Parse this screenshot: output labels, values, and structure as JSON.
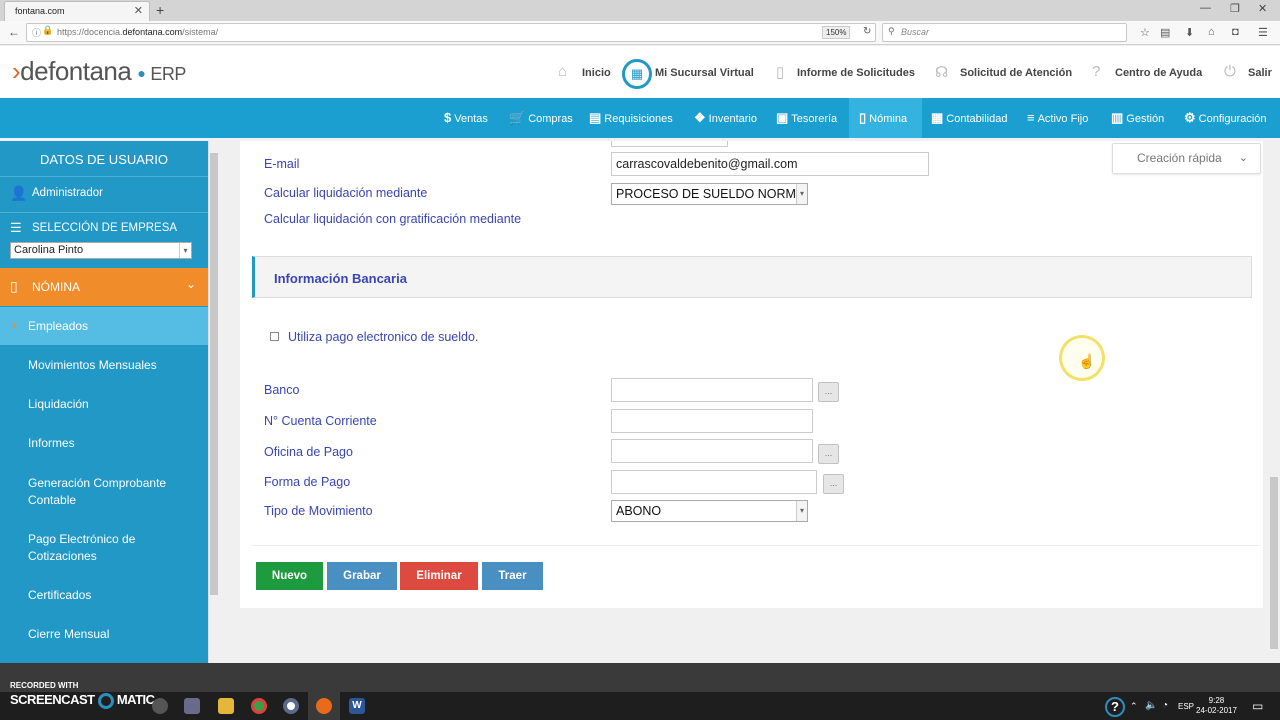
{
  "browser": {
    "tab_title": "fontana.com",
    "url_prefix": "https://docencia.",
    "url_domain": "defontana.com",
    "url_path": "/sistema/",
    "zoom": "150%",
    "search_placeholder": "Buscar"
  },
  "header": {
    "logo_main": "defontana",
    "logo_suffix": "ERP",
    "links": [
      "Inicio",
      "Mi Sucursal Virtual",
      "Informe de Solicitudes",
      "Solicitud de Atención",
      "Centro de Ayuda",
      "Salir"
    ]
  },
  "mainnav": {
    "items": [
      "Ventas",
      "Compras",
      "Requisiciones",
      "Inventario",
      "Tesorería",
      "Nómina",
      "Contabilidad",
      "Activo Fijo",
      "Gestión",
      "Configuración"
    ],
    "active": "Nómina"
  },
  "sidebar": {
    "title": "DATOS DE USUARIO",
    "user": "Administrador",
    "company_heading": "SELECCIÓN DE EMPRESA",
    "company_selected": "Carolina Pinto",
    "module": "NÓMINA",
    "items": [
      "Empleados",
      "Movimientos Mensuales",
      "Liquidación",
      "Informes",
      "Generación Comprobante Contable",
      "Pago Electrónico de Cotizaciones",
      "Certificados",
      "Cierre Mensual"
    ]
  },
  "form": {
    "email_label": "E-mail",
    "email_value": "carrascovaldebenito@gmail.com",
    "calc_label": "Calcular liquidación mediante",
    "calc_value": "PROCESO DE SUELDO NORMAL",
    "calc_grat_label": "Calcular liquidación con gratificación mediante",
    "bank_section": "Información Bancaria",
    "electronic_pay_label": "Utiliza pago electronico de sueldo.",
    "banco_label": "Banco",
    "cuenta_label": "N° Cuenta Corriente",
    "oficina_label": "Oficina de Pago",
    "forma_label": "Forma de Pago",
    "tipo_label": "Tipo de Movimiento",
    "tipo_value": "ABONO",
    "dots": "..."
  },
  "quick_create": "Creación rápida",
  "buttons": {
    "nuevo": "Nuevo",
    "grabar": "Grabar",
    "eliminar": "Eliminar",
    "traer": "Traer"
  },
  "colors": {
    "nav_blue": "#1a9fd0",
    "sidebar_blue": "#2198c6",
    "nomina_orange": "#f08c2a",
    "label_blue": "#3a45b5",
    "btn_green": "#1e9b3f",
    "btn_blue": "#4a8fc2",
    "btn_red": "#dd4a3f"
  },
  "taskbar": {
    "recorded_with": "RECORDED WITH",
    "screencast": "SCREENCAST",
    "matic": "MATIC",
    "lang": "ESP",
    "time": "9:28",
    "date": "24-02-2017"
  }
}
